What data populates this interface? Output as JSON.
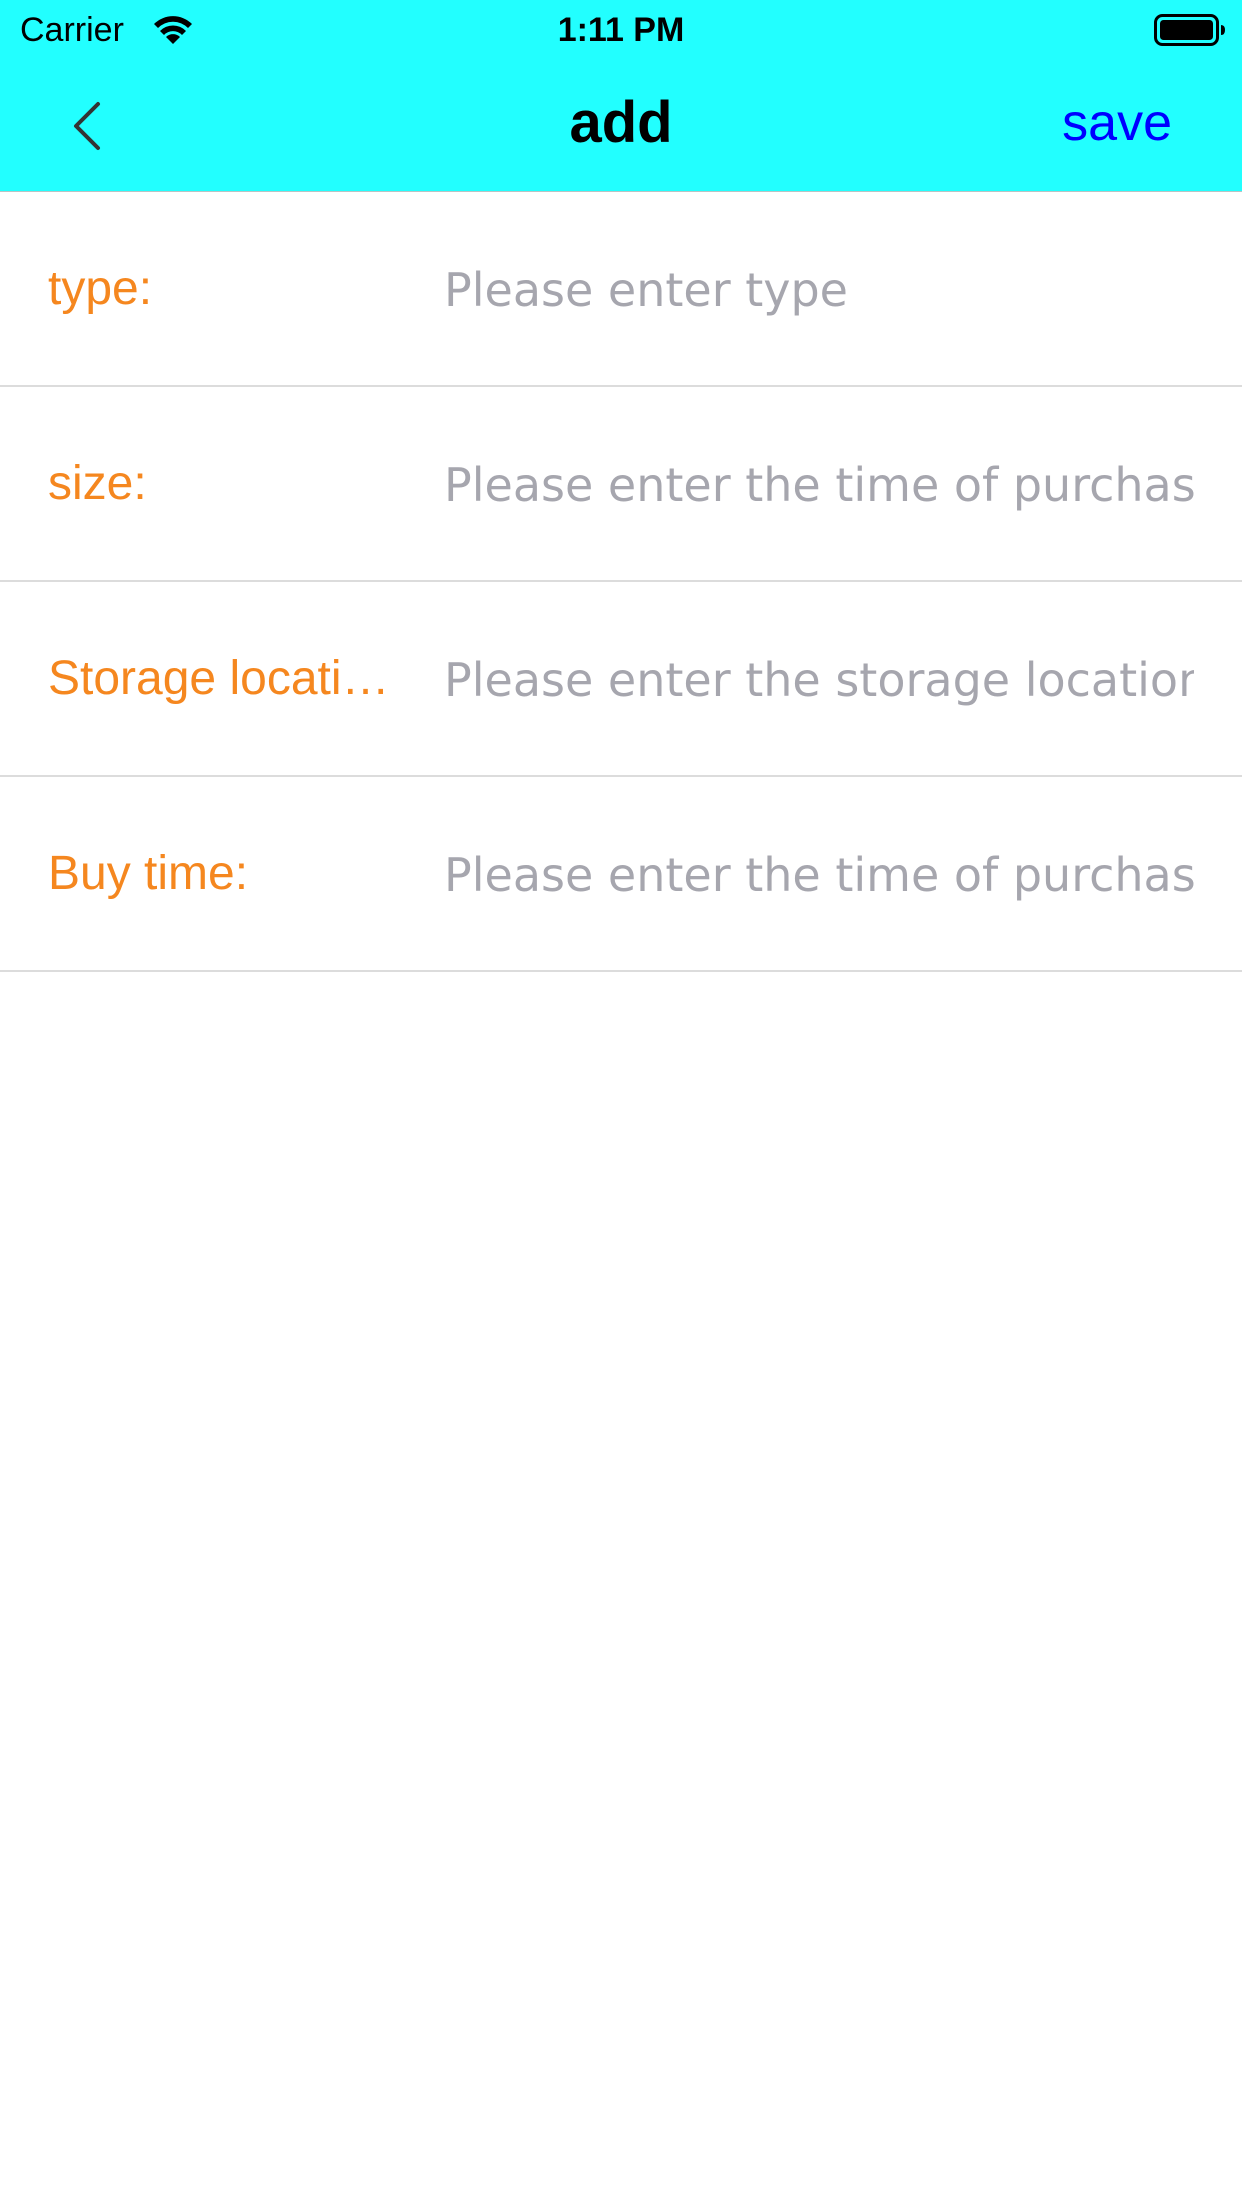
{
  "status_bar": {
    "carrier": "Carrier",
    "time": "1:11 PM",
    "icons": [
      "wifi-icon",
      "battery-icon"
    ]
  },
  "nav": {
    "back_icon": "chevron-left-icon",
    "title": "add",
    "save_label": "save"
  },
  "colors": {
    "header_bg": "#22ffff",
    "label": "#f5871f",
    "save": "#0000ff",
    "placeholder": "#a6a6ae"
  },
  "form": {
    "fields": [
      {
        "label": "type:",
        "value": "",
        "placeholder": "Please enter type"
      },
      {
        "label": "size:",
        "value": "",
        "placeholder": "Please enter the time of purchase"
      },
      {
        "label": "Storage location:",
        "value": "",
        "placeholder": "Please enter the storage location"
      },
      {
        "label": "Buy time:",
        "value": "",
        "placeholder": "Please enter the time of purchase"
      }
    ]
  }
}
